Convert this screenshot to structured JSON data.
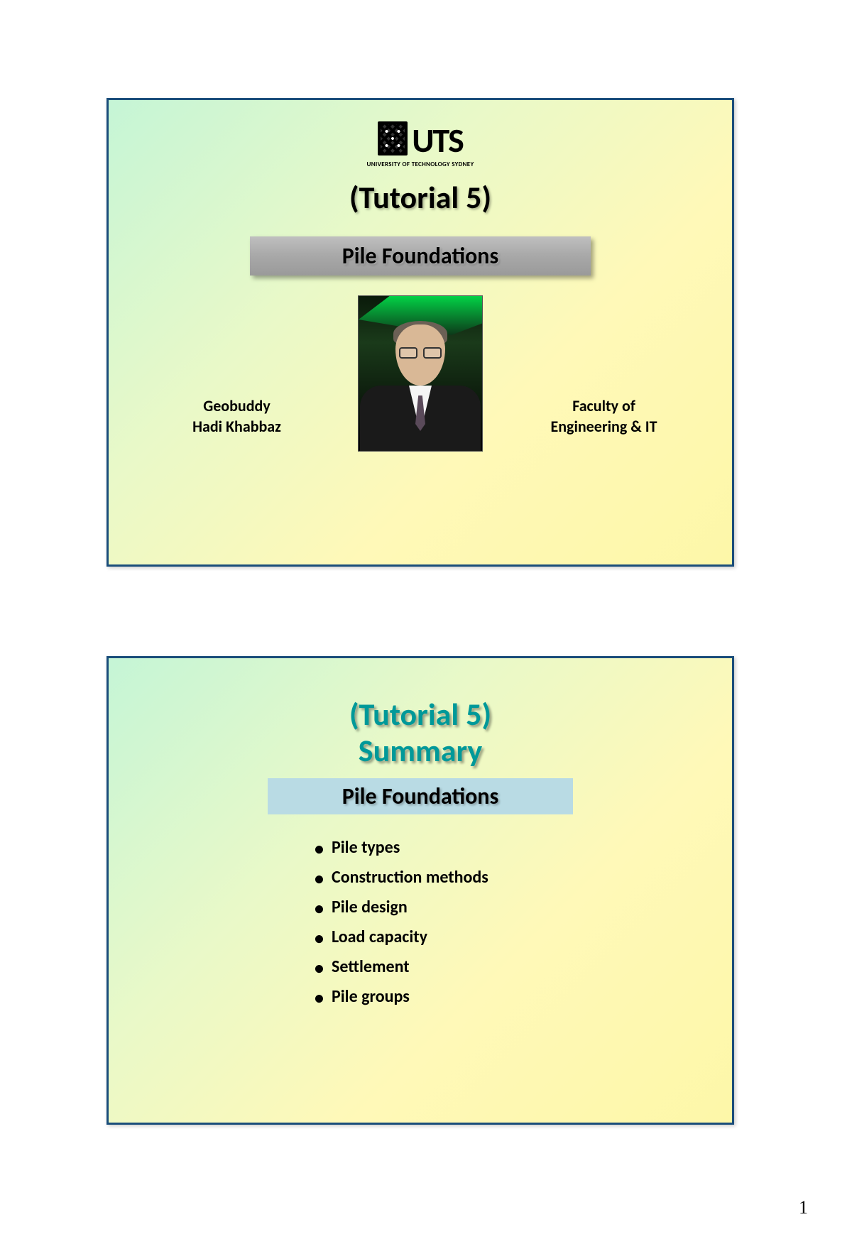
{
  "page_number": "1",
  "slide1": {
    "logo_text": "UTS",
    "logo_subtext": "UNIVERSITY OF TECHNOLOGY SYDNEY",
    "title": "(Tutorial 5)",
    "subject": "Pile Foundations",
    "left_line1": "Geobuddy",
    "left_line2": "Hadi Khabbaz",
    "right_line1": "Faculty of",
    "right_line2": "Engineering & IT"
  },
  "slide2": {
    "title_line1": "(Tutorial 5)",
    "title_line2": "Summary",
    "subject": "Pile Foundations",
    "bullets": [
      "Pile types",
      "Construction methods",
      "Pile design",
      "Load capacity",
      "Settlement",
      "Pile groups"
    ]
  }
}
